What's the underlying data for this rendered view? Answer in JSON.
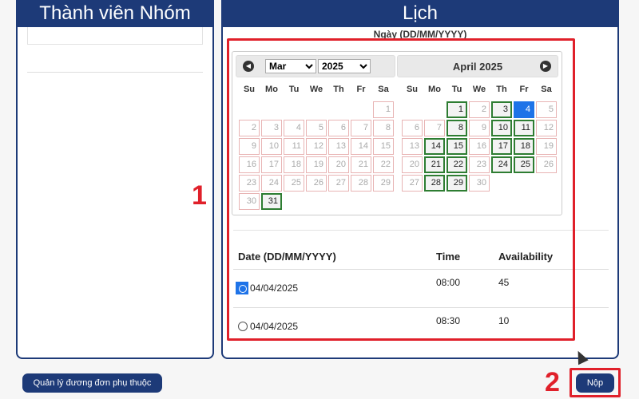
{
  "left_panel": {
    "title": "Thành viên Nhóm"
  },
  "right_panel": {
    "title": "Lịch",
    "subtitle": "Ngày (DD/MM/YYYY)"
  },
  "datepicker": {
    "month_selected": "Mar",
    "year_selected": "2025",
    "right_title": "April 2025",
    "weekdays": [
      "Su",
      "Mo",
      "Tu",
      "We",
      "Th",
      "Fr",
      "Sa"
    ],
    "march": {
      "offset": 6,
      "days": 31,
      "available": [
        31
      ]
    },
    "april": {
      "offset": 2,
      "days": 30,
      "available": [
        1,
        3,
        4,
        8,
        10,
        11,
        14,
        15,
        17,
        18,
        21,
        22,
        24,
        25,
        28,
        29
      ],
      "selected": 4
    }
  },
  "table": {
    "headers": {
      "date": "Date (DD/MM/YYYY)",
      "time": "Time",
      "availability": "Availability"
    },
    "rows": [
      {
        "date": "04/04/2025",
        "time": "08:00",
        "availability": "45",
        "checked": true
      },
      {
        "date": "04/04/2025",
        "time": "08:30",
        "availability": "10",
        "checked": false
      }
    ]
  },
  "buttons": {
    "dependents": "Quản lý đương đơn phụ thuộc",
    "submit": "Nộp"
  },
  "annotations": {
    "one": "1",
    "two": "2"
  },
  "colors": {
    "brand": "#1d3a78",
    "selected": "#1e73e8",
    "available_border": "#2e7d32",
    "annotation": "#e0202a"
  }
}
